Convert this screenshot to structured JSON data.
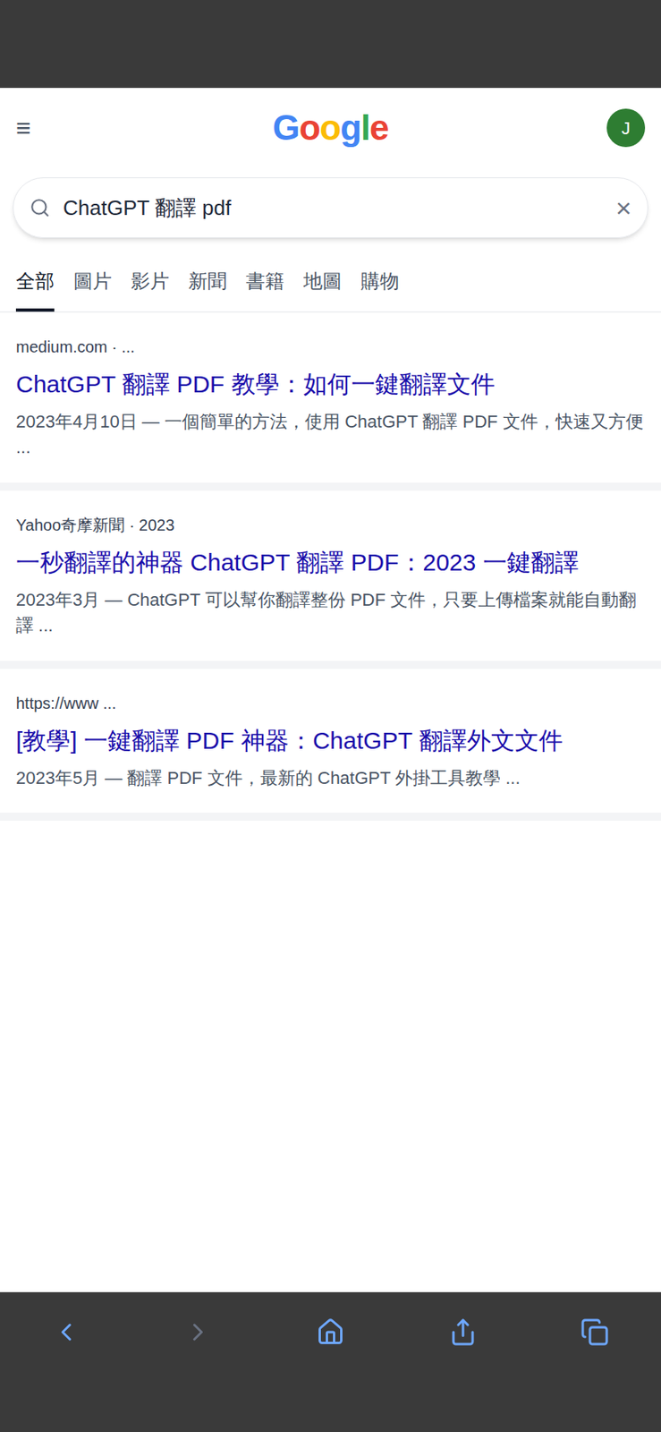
{
  "header": {
    "menu": "≡",
    "logo": [
      {
        "letter": "G",
        "color": "#4285f4"
      },
      {
        "letter": "o",
        "color": "#ea4335"
      },
      {
        "letter": "o",
        "color": "#fbbc05"
      },
      {
        "letter": "g",
        "color": "#4285f4"
      },
      {
        "letter": "l",
        "color": "#34a853"
      },
      {
        "letter": "e",
        "color": "#ea4335"
      }
    ],
    "avatar": "J"
  },
  "search": {
    "query": "ChatGPT 翻譯 pdf",
    "clear": "×"
  },
  "tabs": [
    {
      "label": "全部",
      "selected": true
    },
    {
      "label": "圖片",
      "selected": false
    },
    {
      "label": "影片",
      "selected": false
    },
    {
      "label": "新聞",
      "selected": false
    },
    {
      "label": "書籍",
      "selected": false
    },
    {
      "label": "地圖",
      "selected": false
    },
    {
      "label": "購物",
      "selected": false
    }
  ],
  "results": [
    {
      "source": "medium.com · ...",
      "title": "ChatGPT 翻譯 PDF 教學：如何一鍵翻譯文件",
      "snippet": "2023年4月10日 — 一個簡單的方法，使用 ChatGPT 翻譯 PDF 文件，快速又方便 ..."
    },
    {
      "source": "Yahoo奇摩新聞 · 2023",
      "title": "一秒翻譯的神器 ChatGPT 翻譯 PDF：2023 一鍵翻譯",
      "snippet": "2023年3月 — ChatGPT 可以幫你翻譯整份 PDF 文件，只要上傳檔案就能自動翻譯 ..."
    },
    {
      "source": "https://www ...",
      "title": "[教學] 一鍵翻譯 PDF 神器：ChatGPT 翻譯外文文件",
      "snippet": "2023年5月 — 翻譯 PDF 文件，最新的 ChatGPT 外掛工具教學 ..."
    }
  ]
}
